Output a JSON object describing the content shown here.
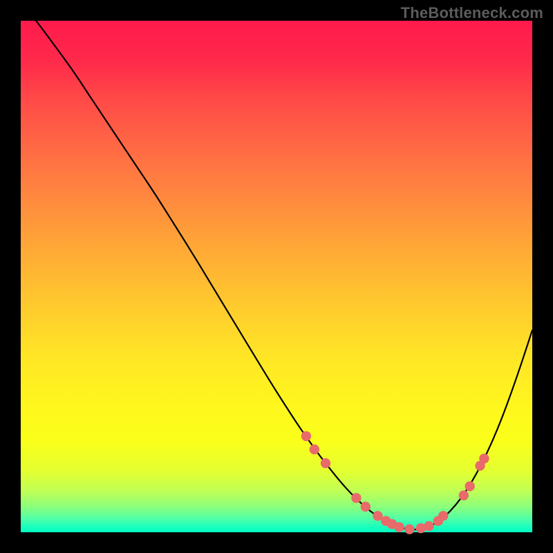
{
  "attribution": "TheBottleneck.com",
  "colors": {
    "page_bg": "#000000",
    "gradient_top": "#ff1a4d",
    "gradient_bottom": "#00ffc0",
    "curve": "#000000",
    "markers": "#e86a6a"
  },
  "chart_data": {
    "type": "line",
    "title": "",
    "xlabel": "",
    "ylabel": "",
    "xlim": [
      0,
      100
    ],
    "ylim": [
      0,
      100
    ],
    "grid": false,
    "legend": false,
    "series": [
      {
        "name": "curve",
        "x": [
          3,
          6,
          10,
          14,
          18,
          22,
          26,
          30,
          34,
          38,
          42,
          46,
          50,
          54,
          56,
          58,
          60,
          62,
          64,
          66,
          68,
          70,
          72,
          74,
          76,
          78,
          80,
          82,
          84,
          86,
          88,
          90,
          92,
          94,
          96,
          98,
          100
        ],
        "y": [
          100,
          96,
          90.5,
          84.5,
          78.5,
          72.5,
          66.5,
          60.2,
          53.8,
          47.2,
          40.6,
          34,
          27.5,
          21.3,
          18.4,
          15.6,
          13,
          10.5,
          8.2,
          6.2,
          4.4,
          3,
          1.8,
          1,
          0.6,
          0.6,
          1.2,
          2.4,
          4.2,
          6.6,
          9.6,
          13.2,
          17.4,
          22.2,
          27.6,
          33.4,
          39.5
        ]
      }
    ],
    "markers": [
      {
        "x": 55.8,
        "y": 18.8
      },
      {
        "x": 57.4,
        "y": 16.2
      },
      {
        "x": 59.6,
        "y": 13.5
      },
      {
        "x": 65.6,
        "y": 6.7
      },
      {
        "x": 67.4,
        "y": 5.0
      },
      {
        "x": 69.8,
        "y": 3.2
      },
      {
        "x": 71.4,
        "y": 2.2
      },
      {
        "x": 72.6,
        "y": 1.6
      },
      {
        "x": 74.0,
        "y": 1.0
      },
      {
        "x": 76.0,
        "y": 0.6
      },
      {
        "x": 78.2,
        "y": 0.8
      },
      {
        "x": 79.8,
        "y": 1.2
      },
      {
        "x": 81.6,
        "y": 2.2
      },
      {
        "x": 82.6,
        "y": 3.2
      },
      {
        "x": 86.6,
        "y": 7.2
      },
      {
        "x": 87.8,
        "y": 9.0
      },
      {
        "x": 89.8,
        "y": 13.0
      },
      {
        "x": 90.6,
        "y": 14.4
      }
    ]
  }
}
